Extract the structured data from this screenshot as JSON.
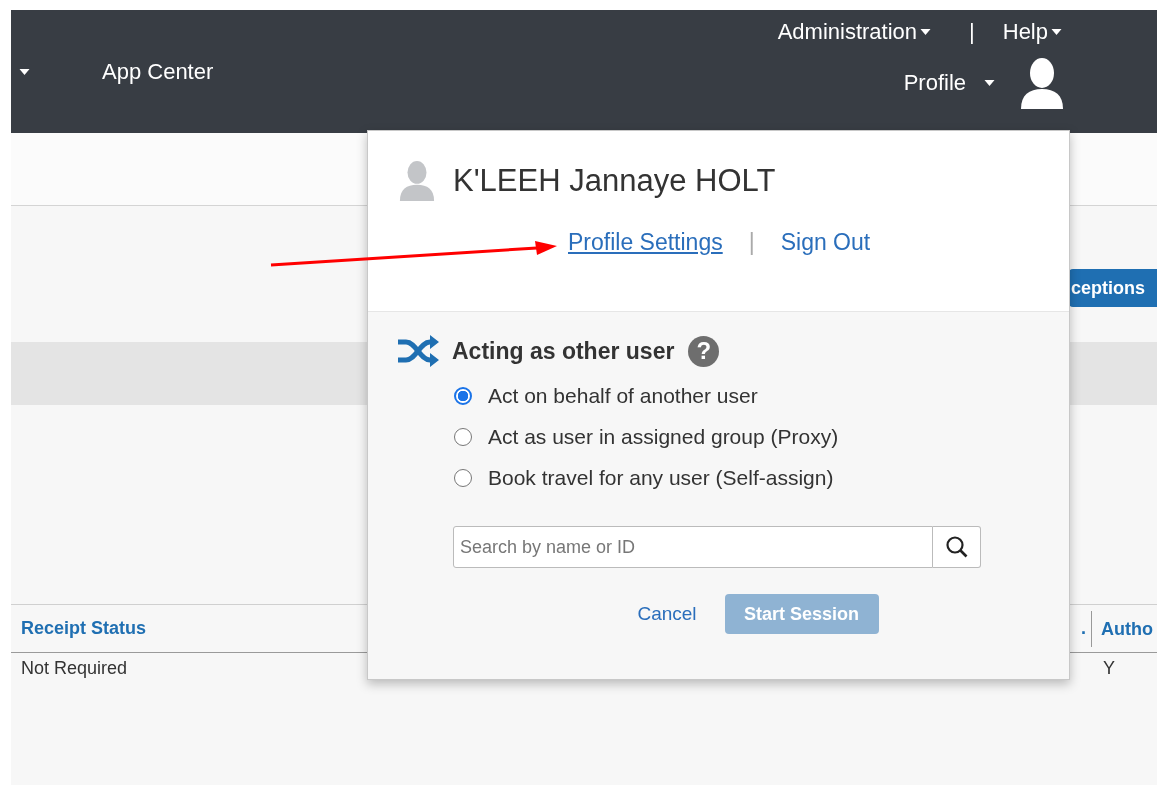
{
  "header": {
    "nav": [
      {
        "label": "App Center"
      }
    ],
    "top_links": [
      {
        "label": "Administration"
      },
      {
        "label": "Help"
      }
    ],
    "separator": "|",
    "profile": "Profile"
  },
  "toolbar": {
    "button": "ceptions"
  },
  "table": {
    "columns": [
      {
        "label": "Receipt Status"
      },
      {
        "label": "."
      },
      {
        "label": "Autho"
      }
    ],
    "rows": [
      {
        "cells": [
          "Not Required",
          "",
          "Y"
        ]
      }
    ]
  },
  "profile_menu": {
    "user_name": "K'LEEH Jannaye HOLT",
    "links": [
      {
        "label": "Profile Settings",
        "underlined": true
      },
      {
        "label": "Sign Out",
        "underlined": false
      }
    ],
    "link_separator": "|",
    "section_title": "Acting as other user",
    "help": "?",
    "options": [
      {
        "label": "Act on behalf of another user",
        "selected": true
      },
      {
        "label": "Act as user in assigned group (Proxy)",
        "selected": false
      },
      {
        "label": "Book travel for any user (Self-assign)",
        "selected": false
      }
    ],
    "search": {
      "placeholder": "Search by name or ID"
    },
    "buttons": [
      {
        "label": "Cancel",
        "kind": "link",
        "disabled": false
      },
      {
        "label": "Start Session",
        "kind": "primary",
        "disabled": true
      }
    ]
  }
}
